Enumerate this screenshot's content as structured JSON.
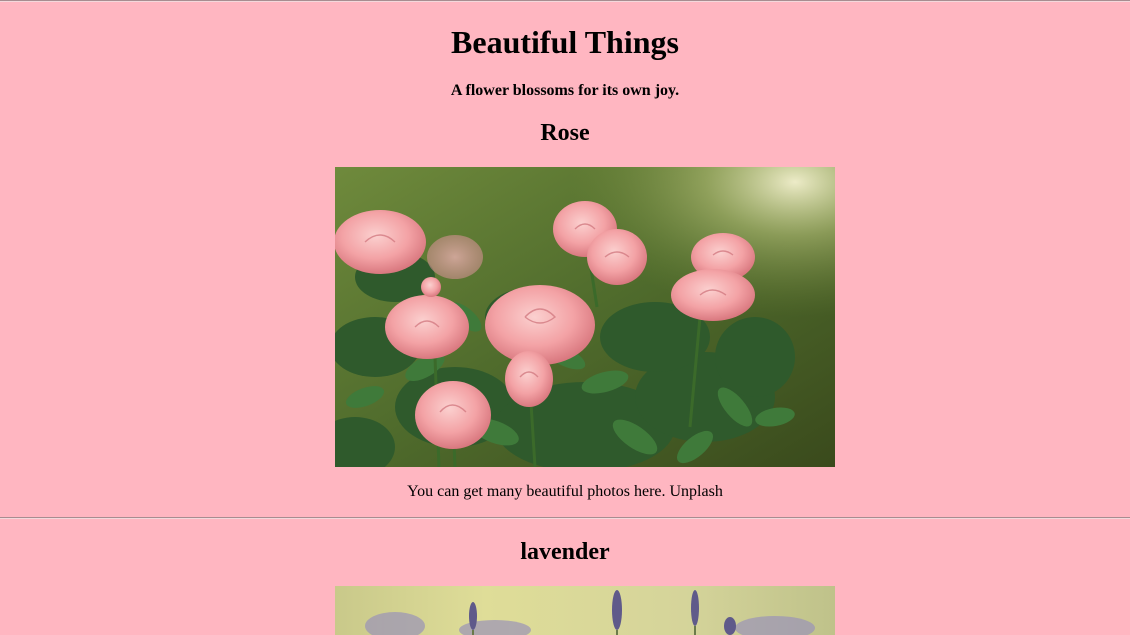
{
  "header": {
    "title": "Beautiful Things",
    "subtitle": "A flower blossoms for its own joy."
  },
  "sections": [
    {
      "title": "Rose",
      "image_subject": "pink roses on a green bush",
      "caption_text": "You can get many beautiful photos here.",
      "caption_link": "Unplash"
    },
    {
      "title": "lavender",
      "image_subject": "lavender flowers on a yellow-green background"
    }
  ],
  "colors": {
    "background": "#ffb6c1",
    "text": "#000000",
    "rule": "#a88c90"
  }
}
